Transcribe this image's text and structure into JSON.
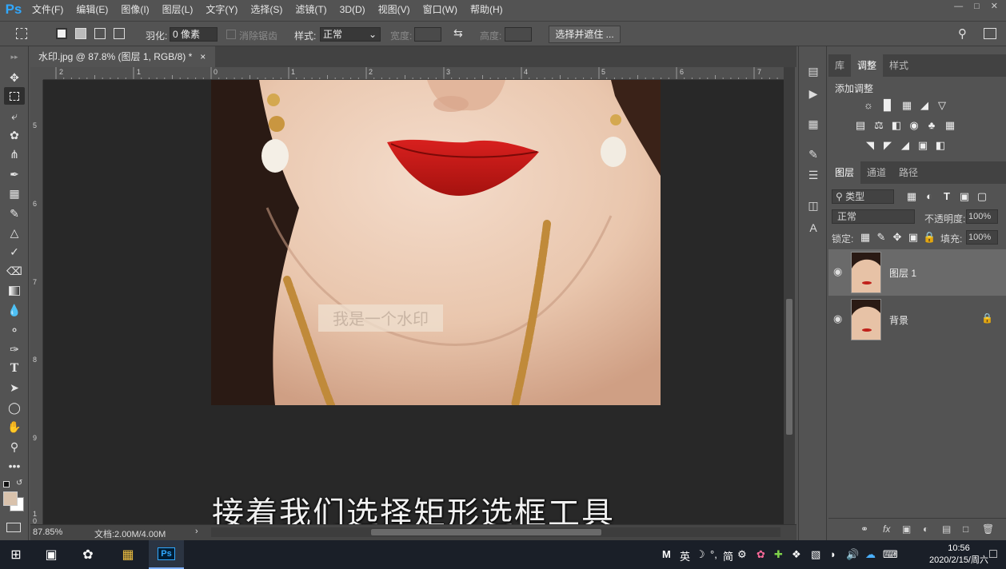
{
  "menubar": {
    "logo": "Ps",
    "items": [
      "文件(F)",
      "编辑(E)",
      "图像(I)",
      "图层(L)",
      "文字(Y)",
      "选择(S)",
      "滤镜(T)",
      "3D(D)",
      "视图(V)",
      "窗口(W)",
      "帮助(H)"
    ]
  },
  "options": {
    "feather_label": "羽化:",
    "feather_value": "0 像素",
    "antialias_label": "消除锯齿",
    "style_label": "样式:",
    "style_value": "正常",
    "width_label": "宽度:",
    "height_label": "高度:",
    "select_mask_button": "选择并遮住 ..."
  },
  "document": {
    "tab_title": "水印.jpg @ 87.8% (图层 1, RGB/8) *",
    "close_glyph": "×",
    "watermark_text": "我是一个水印",
    "subtitle": "接着我们选择矩形选框工具"
  },
  "ruler": {
    "top": [
      "2",
      "1",
      "0",
      "1",
      "2",
      "3",
      "4",
      "5",
      "6",
      "7"
    ],
    "left": [
      "5",
      "6",
      "7",
      "8",
      "9",
      "1",
      "0"
    ]
  },
  "status": {
    "zoom": "87.85%",
    "doc_info": "文档:2.00M/4.00M",
    "arrow": "›"
  },
  "panels": {
    "top_tabs": [
      "库",
      "调整",
      "样式"
    ],
    "active_top_tab": "调整",
    "add_adjustment": "添加调整",
    "layer_tabs": [
      "图层",
      "通道",
      "路径"
    ],
    "active_layer_tab": "图层",
    "filter_kind": "类型",
    "blend_mode": "正常",
    "opacity_label": "不透明度:",
    "opacity_value": "100%",
    "lock_label": "锁定:",
    "fill_label": "填充:",
    "fill_value": "100%",
    "layers": [
      {
        "name": "图层 1",
        "selected": true,
        "locked": false
      },
      {
        "name": "背景",
        "selected": false,
        "locked": true
      }
    ]
  },
  "taskbar": {
    "time": "10:56",
    "date": "2020/2/15/周六",
    "ime": [
      "M",
      "英",
      "简"
    ]
  },
  "colors": {
    "accent": "#31a8ff",
    "panel": "#535353",
    "canvas": "#282828"
  }
}
